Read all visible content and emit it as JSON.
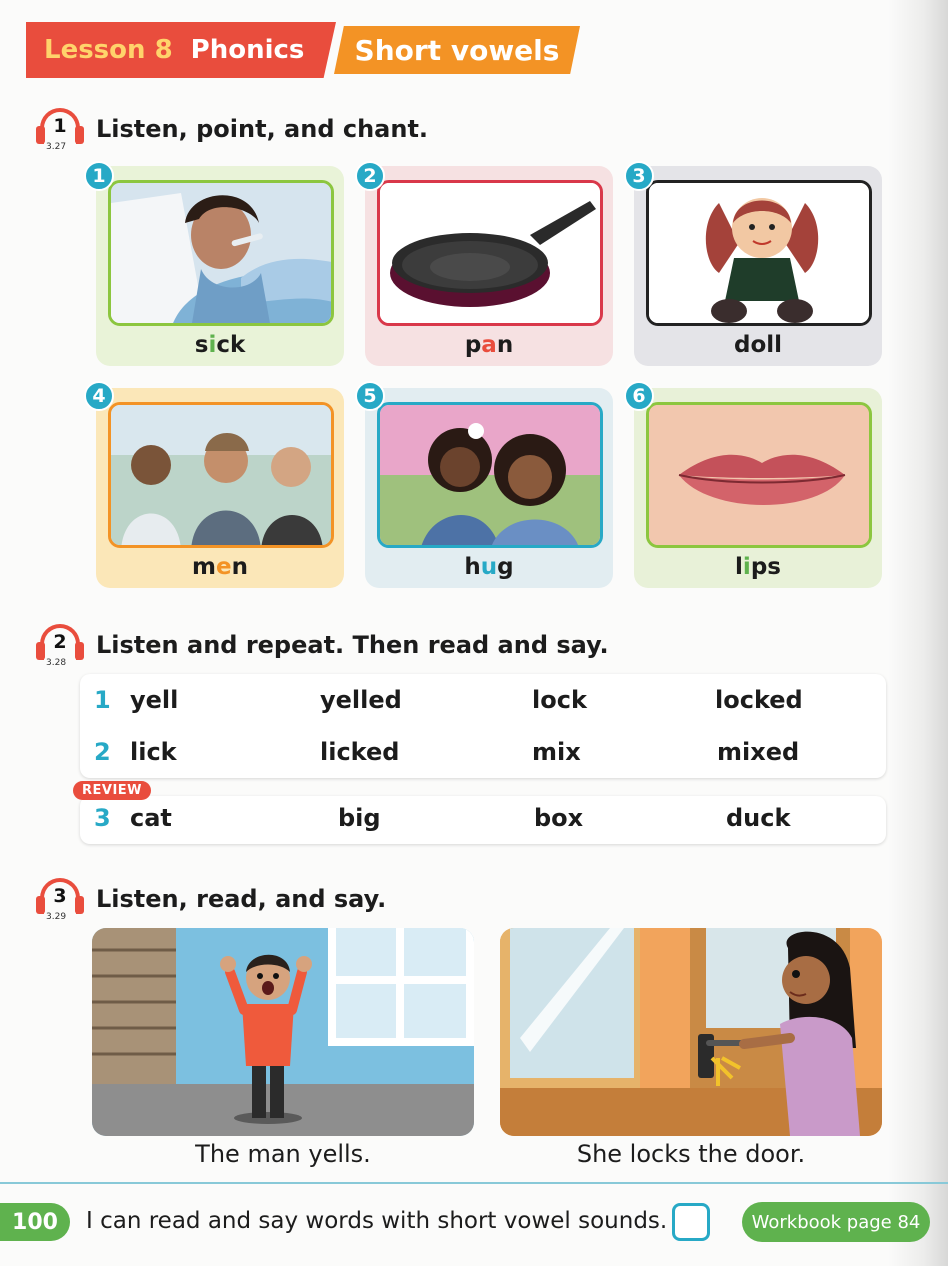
{
  "header": {
    "lesson": "Lesson 8",
    "section": "Phonics",
    "topic": "Short vowels"
  },
  "activity1": {
    "number": "1",
    "track": "3.27",
    "title": "Listen, point, and chant.",
    "items": [
      {
        "number": "1",
        "pre": "s",
        "vowel": "i",
        "post": "ck",
        "vowel_color": "#5fb24e"
      },
      {
        "number": "2",
        "pre": "p",
        "vowel": "a",
        "post": "n",
        "vowel_color": "#e94d3d"
      },
      {
        "number": "3",
        "pre": "d",
        "vowel": "o",
        "post": "ll",
        "vowel_color": "#1c1c1c"
      },
      {
        "number": "4",
        "pre": "m",
        "vowel": "e",
        "post": "n",
        "vowel_color": "#f39325"
      },
      {
        "number": "5",
        "pre": "h",
        "vowel": "u",
        "post": "g",
        "vowel_color": "#27a9c6"
      },
      {
        "number": "6",
        "pre": "l",
        "vowel": "i",
        "post": "ps",
        "vowel_color": "#5fb24e"
      }
    ]
  },
  "activity2": {
    "number": "2",
    "track": "3.28",
    "title": "Listen and repeat. Then read and say.",
    "rows": [
      {
        "n": "1",
        "w": [
          "yell",
          "yelled",
          "lock",
          "locked"
        ]
      },
      {
        "n": "2",
        "w": [
          "lick",
          "licked",
          "mix",
          "mixed"
        ]
      }
    ],
    "review_label": "REVIEW",
    "review_row": {
      "n": "3",
      "w": [
        "cat",
        "big",
        "box",
        "duck"
      ]
    }
  },
  "activity3": {
    "number": "3",
    "track": "3.29",
    "title": "Listen, read, and say.",
    "captions": [
      "The man yells.",
      "She locks the door."
    ]
  },
  "footer": {
    "page": "100",
    "can_do": "I can read and say words with short vowel sounds.",
    "workbook": "Workbook page 84"
  },
  "colors": {
    "red": "#e94d3d",
    "orange": "#f39325",
    "teal": "#27a9c6",
    "green": "#5fb24e"
  }
}
